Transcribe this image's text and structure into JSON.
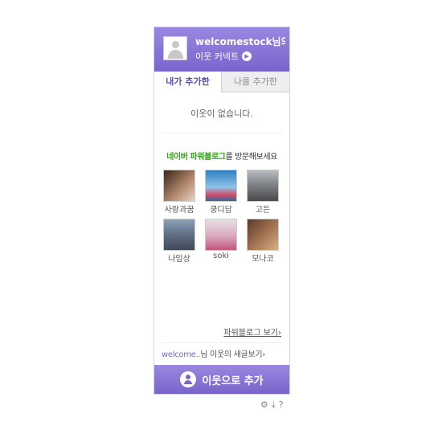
{
  "header": {
    "username": "welcomestock님의",
    "connect_label": "이웃 커넥트",
    "connect_icon": "play-icon"
  },
  "tabs": [
    {
      "label": "내가 추가한",
      "active": true
    },
    {
      "label": "나를 추가한",
      "active": false
    }
  ],
  "empty_message": "이웃이 없습니다.",
  "promo": {
    "highlight": "네이버 파워블로그",
    "rest": "를 방문해보세요"
  },
  "blogs": [
    {
      "name": "사랑과꿈",
      "thumb_color": "#6b4a3c"
    },
    {
      "name": "쿵디담",
      "thumb_color": "#3e88b8"
    },
    {
      "name": "고든",
      "thumb_color": "#8c8c8c"
    },
    {
      "name": "나임상",
      "thumb_color": "#6e7e94"
    },
    {
      "name": "soki",
      "thumb_color": "#c78aa6"
    },
    {
      "name": "모나코",
      "thumb_color": "#7a5a44"
    }
  ],
  "powerblog_link": "파워블로그 보기",
  "recent": {
    "nick": "welcome..",
    "text": "님 이웃의 새글보기"
  },
  "add_button": "이웃으로 추가",
  "footer_icons": [
    "gear-icon",
    "download-icon",
    "help-icon"
  ],
  "colors": {
    "accent": "#7a64cc",
    "promo_green": "#34a01b"
  }
}
